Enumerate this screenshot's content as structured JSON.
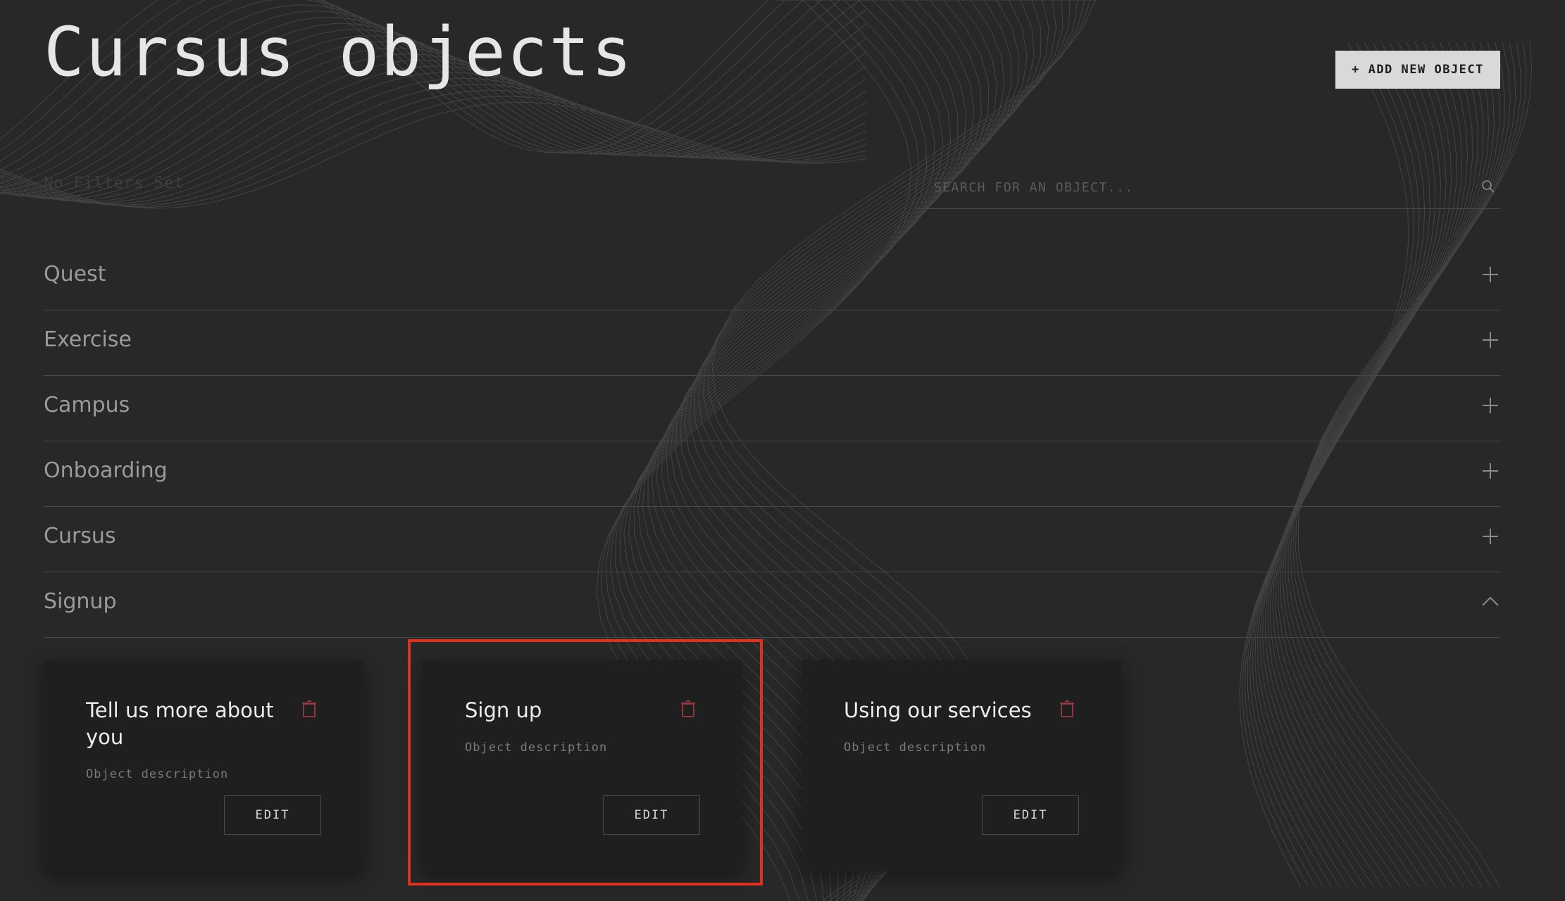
{
  "header": {
    "title": "Cursus objects",
    "add_button_label": "+ ADD NEW OBJECT"
  },
  "filters": {
    "label": "No Filters Set"
  },
  "search": {
    "placeholder": "SEARCH FOR AN OBJECT...",
    "value": "",
    "icon": "search-icon"
  },
  "accordion": {
    "sections": [
      {
        "label": "Quest",
        "expanded": false,
        "icon": "plus-icon"
      },
      {
        "label": "Exercise",
        "expanded": false,
        "icon": "plus-icon"
      },
      {
        "label": "Campus",
        "expanded": false,
        "icon": "plus-icon"
      },
      {
        "label": "Onboarding",
        "expanded": false,
        "icon": "plus-icon"
      },
      {
        "label": "Cursus",
        "expanded": false,
        "icon": "plus-icon"
      },
      {
        "label": "Signup",
        "expanded": true,
        "icon": "chevron-up-icon"
      }
    ]
  },
  "cards": [
    {
      "title": "Tell us more about you",
      "description": "Object description",
      "edit_label": "EDIT",
      "delete_icon": "trash-icon"
    },
    {
      "title": "Sign up",
      "description": "Object description",
      "edit_label": "EDIT",
      "delete_icon": "trash-icon",
      "highlighted": true
    },
    {
      "title": "Using our services",
      "description": "Object description",
      "edit_label": "EDIT",
      "delete_icon": "trash-icon"
    }
  ],
  "colors": {
    "background": "#282828",
    "card": "#1f1f1f",
    "accent_button": "#d9d9d9",
    "trash": "#9b3a40",
    "highlight": "#e0301e"
  }
}
